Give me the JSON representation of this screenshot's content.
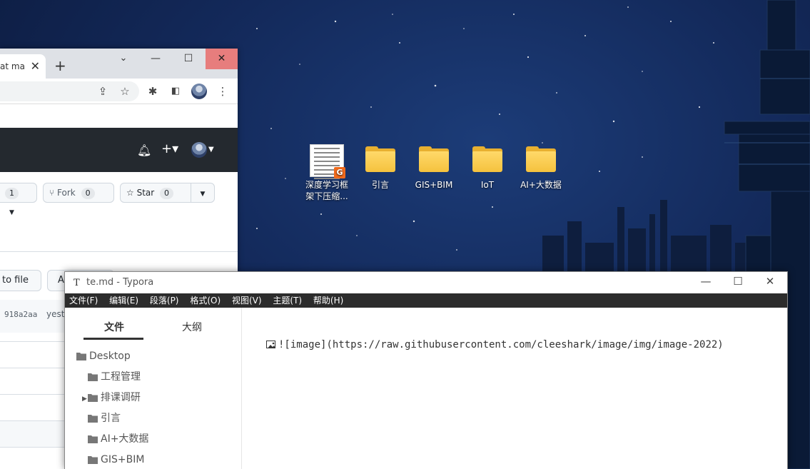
{
  "desktop": {
    "icons": [
      {
        "label": "深度学习框\n架下压缩...",
        "type": "document",
        "badge": "G"
      },
      {
        "label": "引言",
        "type": "folder"
      },
      {
        "label": "GIS+BIM",
        "type": "folder"
      },
      {
        "label": "IoT",
        "type": "folder"
      },
      {
        "label": "AI+大数据",
        "type": "folder"
      }
    ]
  },
  "chrome": {
    "tab_title": "at ma",
    "window_controls": {
      "minimize": "—",
      "maximize": "☐",
      "close": "✕"
    }
  },
  "github": {
    "watch_count": "1",
    "fork_label": "Fork",
    "fork_count": "0",
    "star_label": "Star",
    "star_count": "0",
    "goto_file_label": "to file",
    "add_file_label": "A",
    "commit_hash": "918a2aa",
    "commit_time": "yeste"
  },
  "typora": {
    "window_title": "te.md - Typora",
    "app_icon": "T",
    "menu": [
      "文件(F)",
      "编辑(E)",
      "段落(P)",
      "格式(O)",
      "视图(V)",
      "主题(T)",
      "帮助(H)"
    ],
    "sidebar_tabs": [
      "文件",
      "大纲"
    ],
    "tree": [
      {
        "label": "Desktop",
        "level": 0
      },
      {
        "label": "工程管理",
        "level": 1
      },
      {
        "label": "排课调研",
        "level": 1,
        "collapsible": true
      },
      {
        "label": "引言",
        "level": 1
      },
      {
        "label": "AI+大数据",
        "level": 1
      },
      {
        "label": "GIS+BIM",
        "level": 1
      }
    ],
    "editor_line": "![image](https://raw.githubusercontent.com/cleeshark/image/img/image-2022)"
  },
  "colors": {
    "github_header": "#24292f",
    "chrome_close_hover": "#e77d7d",
    "typora_menubar": "#2c2c2c",
    "folder": "#f5c23e"
  }
}
